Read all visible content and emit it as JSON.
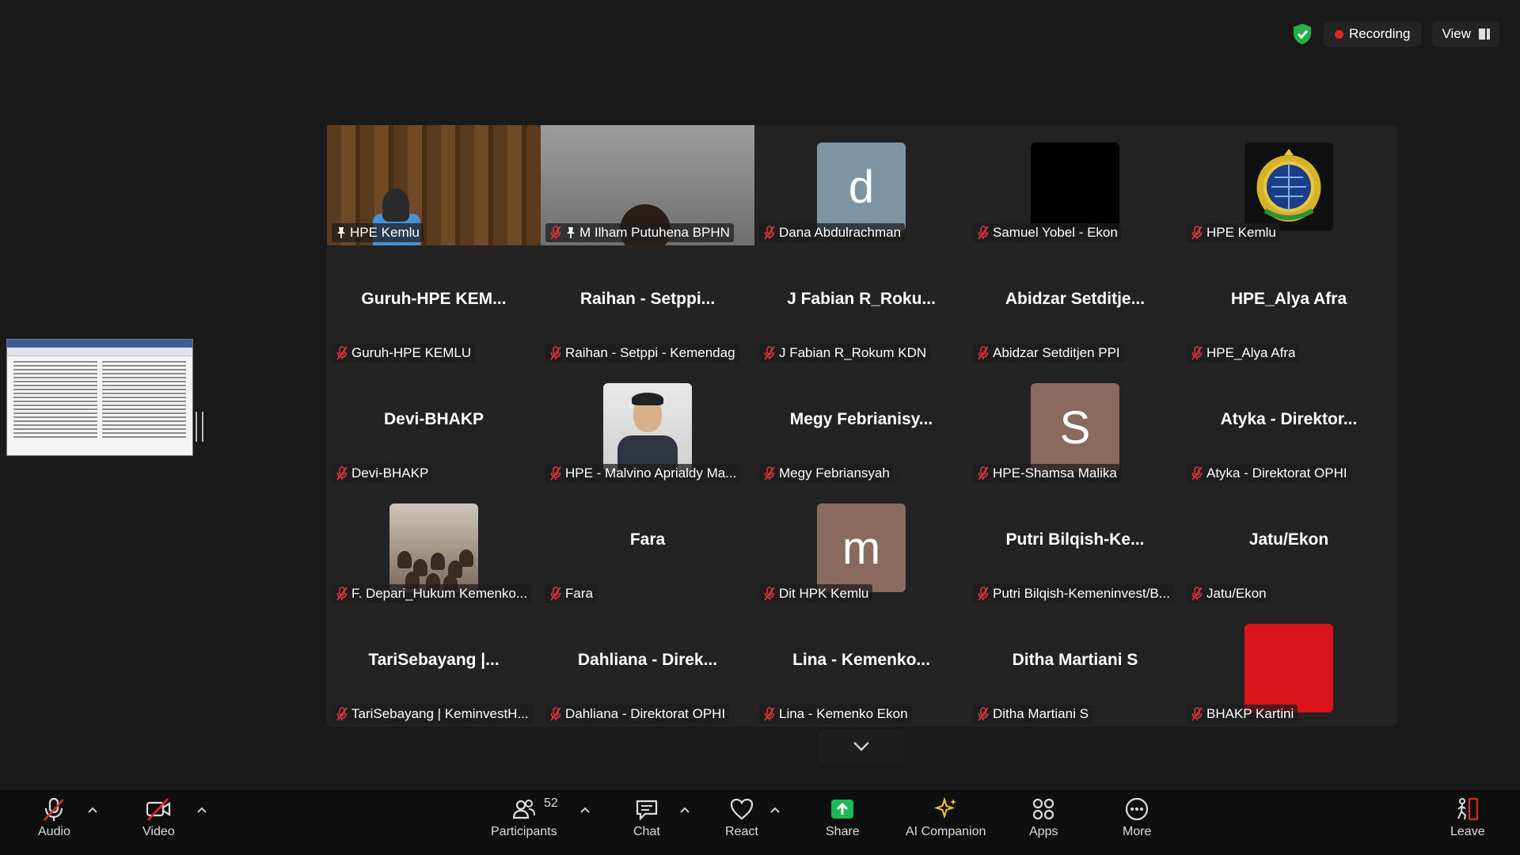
{
  "status": {
    "recording_label": "Recording",
    "view_label": "View"
  },
  "participants": [
    {
      "label": "HPE Kemlu",
      "type": "video",
      "scene": "wood",
      "active": true,
      "pinned": true,
      "muted": false
    },
    {
      "label": "M Ilham Putuhena BPHN",
      "type": "video",
      "scene": "room",
      "pinned": true,
      "muted": true
    },
    {
      "label": "Dana Abdulrachman",
      "type": "avatar",
      "letter": "d",
      "color": "#7f94a3",
      "muted": true
    },
    {
      "label": "Samuel Yobel - Ekon",
      "type": "avatar",
      "letter": "",
      "color": "#000000",
      "muted": true
    },
    {
      "label": "HPE Kemlu",
      "type": "logo",
      "muted": true
    },
    {
      "label": "Guruh-HPE KEMLU",
      "name": "Guruh-HPE  KEM...",
      "type": "name",
      "muted": true
    },
    {
      "label": "Raihan - Setppi - Kemendag",
      "name": "Raihan  -  Setppi...",
      "type": "name",
      "muted": true
    },
    {
      "label": "J Fabian R_Rokum KDN",
      "name": "J  Fabian  R_Roku...",
      "type": "name",
      "muted": true
    },
    {
      "label": "Abidzar Setditjen PPI",
      "name": "Abidzar  Setditje...",
      "type": "name",
      "muted": true
    },
    {
      "label": "HPE_Alya Afra",
      "name": "HPE_Alya  Afra",
      "type": "name",
      "muted": true
    },
    {
      "label": "Devi-BHAKP",
      "name": "Devi-BHAKP",
      "type": "name",
      "muted": true
    },
    {
      "label": "HPE - Malvino Aprialdy Ma...",
      "type": "photo",
      "scene": "portrait",
      "muted": true
    },
    {
      "label": "Megy Febriansyah",
      "name": "Megy  Febrianisy...",
      "type": "name",
      "muted": true
    },
    {
      "label": "HPE-Shamsa Malika",
      "type": "avatar",
      "letter": "S",
      "color": "#8a6a5e",
      "muted": true
    },
    {
      "label": "Atyka - Direktorat OPHI",
      "name": "Atyka  -  Direktor...",
      "type": "name",
      "muted": true
    },
    {
      "label": "F. Depari_Hukum Kemenko...",
      "type": "photo",
      "scene": "meeting",
      "muted": true
    },
    {
      "label": "Fara",
      "name": "Fara",
      "type": "name",
      "muted": true
    },
    {
      "label": "Dit HPK Kemlu",
      "type": "avatar",
      "letter": "m",
      "color": "#8a6a5e",
      "muted": true
    },
    {
      "label": "Putri Bilqish-Kemeninvest/B...",
      "name": "Putri  Bilqish-Ke...",
      "type": "name",
      "muted": true
    },
    {
      "label": "Jatu/Ekon",
      "name": "Jatu/Ekon",
      "type": "name",
      "muted": true
    },
    {
      "label": "TariSebayang | KeminvestH...",
      "name": "TariSebayang  |...",
      "type": "name",
      "muted": true
    },
    {
      "label": "Dahliana - Direktorat OPHI",
      "name": "Dahliana  -  Direk...",
      "type": "name",
      "muted": true
    },
    {
      "label": "Lina - Kemenko Ekon",
      "name": "Lina  -  Kemenko...",
      "type": "name",
      "muted": true
    },
    {
      "label": "Ditha Martiani S",
      "name": "Ditha  Martiani  S",
      "type": "name",
      "muted": true
    },
    {
      "label": "BHAKP Kartini",
      "type": "avatar",
      "letter": "",
      "color": "#d9141c",
      "muted": true
    }
  ],
  "toolbar": {
    "audio": "Audio",
    "video": "Video",
    "participants": "Participants",
    "participants_count": "52",
    "chat": "Chat",
    "react": "React",
    "share": "Share",
    "ai_companion": "AI Companion",
    "apps": "Apps",
    "more": "More",
    "leave": "Leave"
  },
  "icons": {
    "muted_mic": "mic-off-icon",
    "pin": "pin-icon",
    "shield": "shield-check-icon"
  }
}
